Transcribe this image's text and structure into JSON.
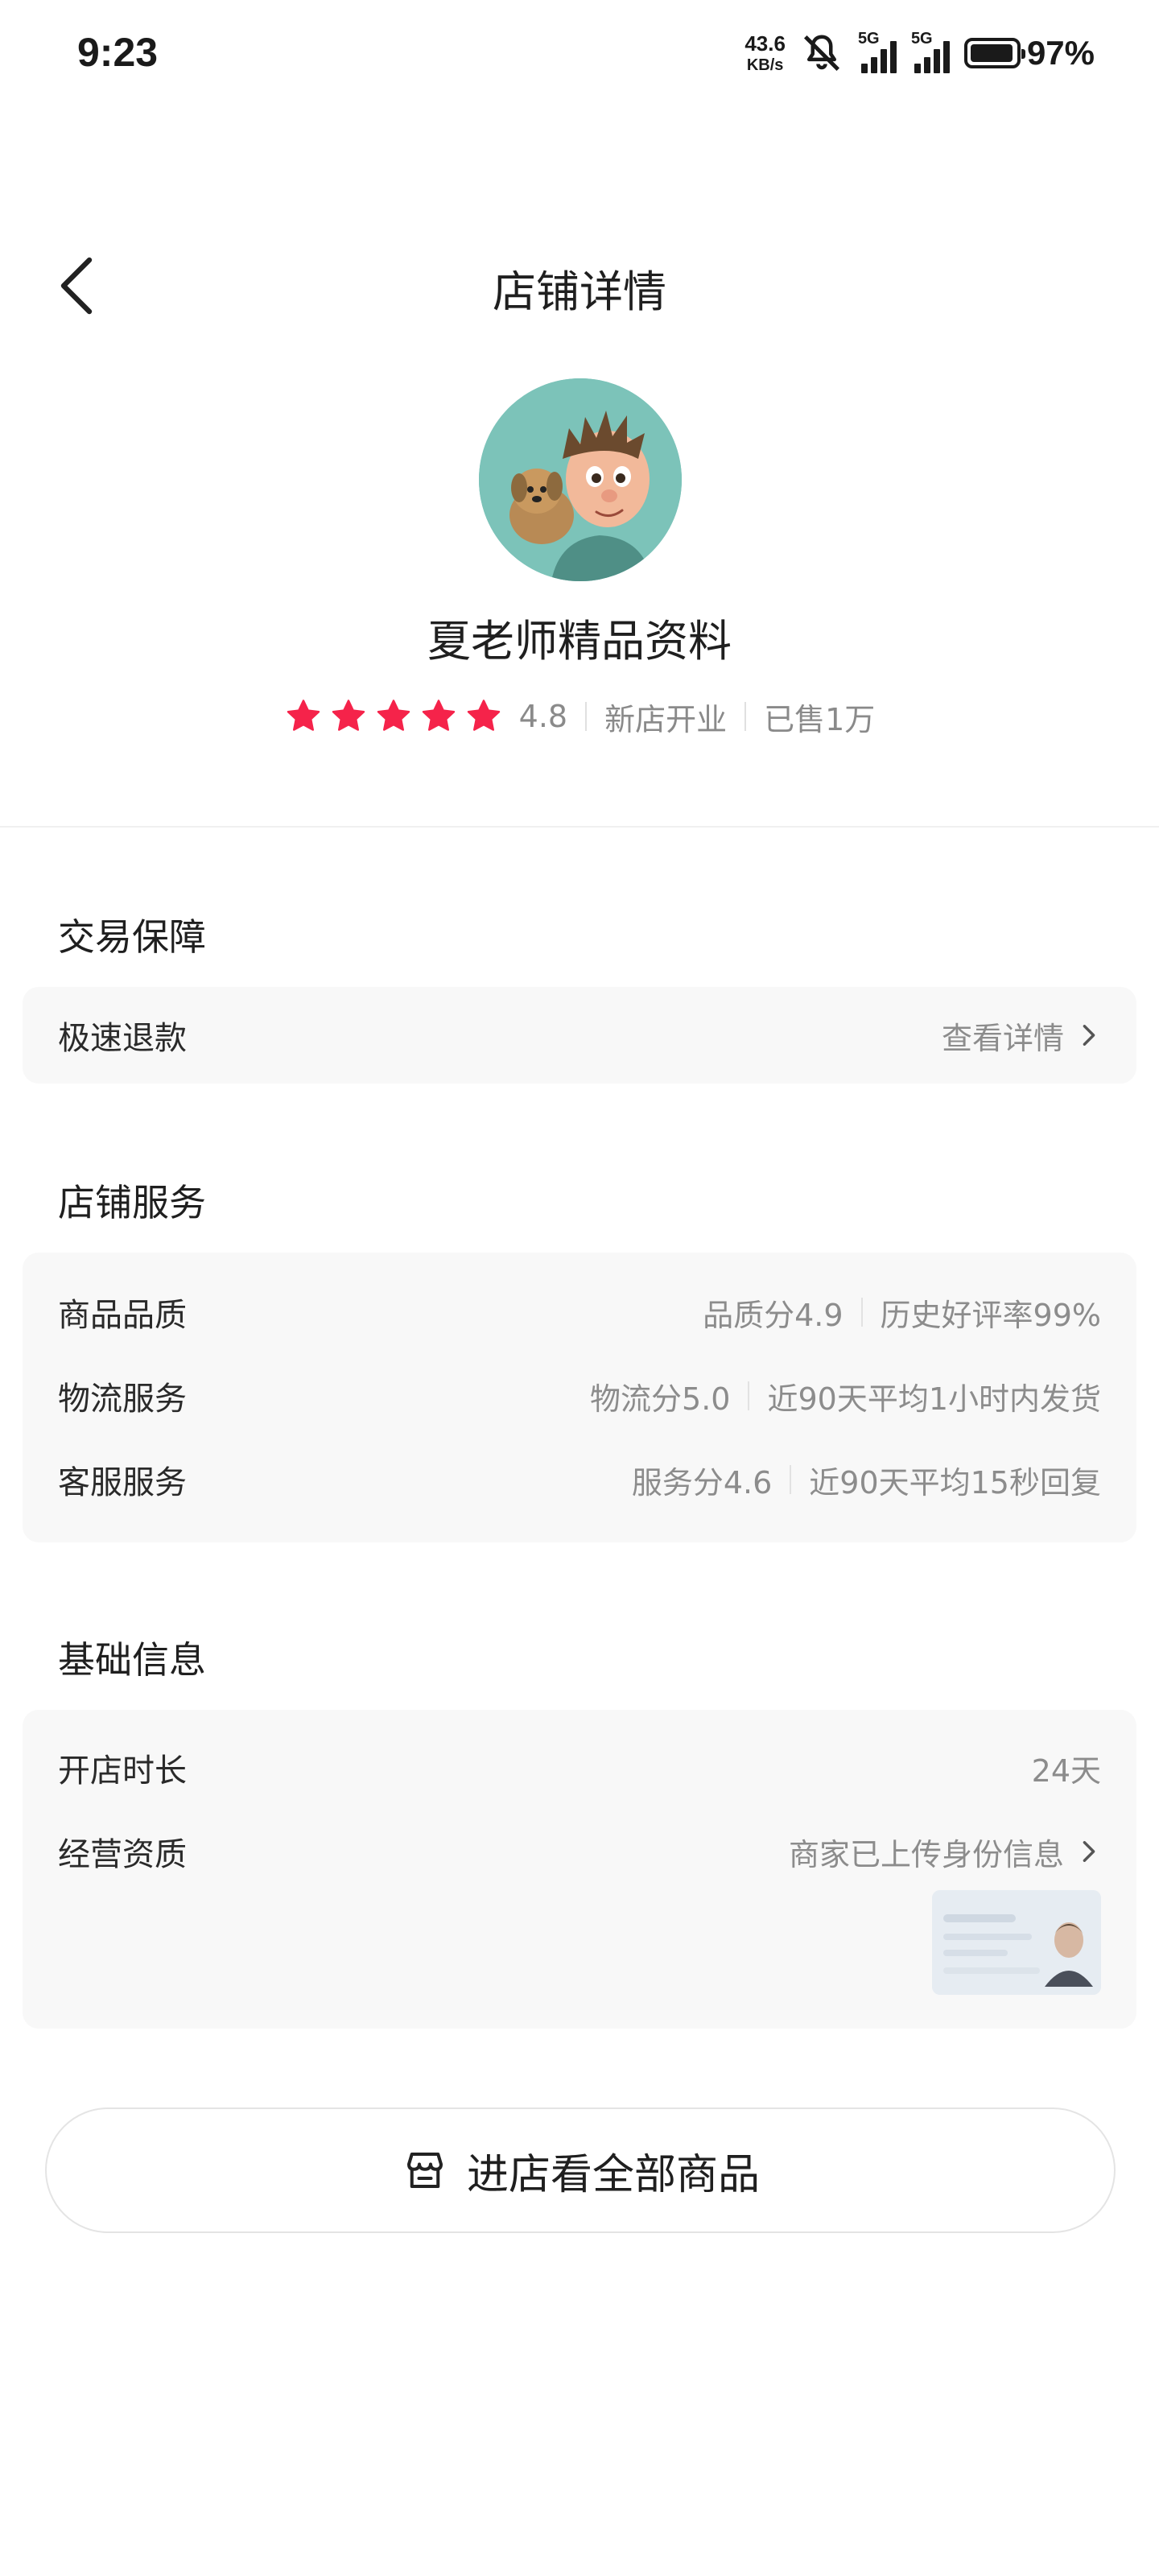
{
  "status_bar": {
    "time": "9:23",
    "net_speed_value": "43.6",
    "net_speed_unit": "KB/s",
    "signal_1_label": "5G",
    "signal_2_label": "5G",
    "battery_percent": "97%",
    "battery_level": 0.97
  },
  "header": {
    "title": "店铺详情"
  },
  "shop": {
    "name": "夏老师精品资料",
    "rating_stars": 5,
    "rating": "4.8",
    "badge": "新店开业",
    "sold": "已售1万"
  },
  "guarantee": {
    "title": "交易保障",
    "row_label": "极速退款",
    "row_action": "查看详情"
  },
  "service": {
    "title": "店铺服务",
    "rows": [
      {
        "label": "商品品质",
        "score": "品质分4.9",
        "detail": "历史好评率99%"
      },
      {
        "label": "物流服务",
        "score": "物流分5.0",
        "detail": "近90天平均1小时内发货"
      },
      {
        "label": "客服服务",
        "score": "服务分4.6",
        "detail": "近90天平均15秒回复"
      }
    ]
  },
  "basic": {
    "title": "基础信息",
    "duration_label": "开店时长",
    "duration_value": "24天",
    "qualification_label": "经营资质",
    "qualification_value": "商家已上传身份信息"
  },
  "enter_button": {
    "label": "进店看全部商品"
  },
  "colors": {
    "star": "#f5234a",
    "muted_text": "#8c8c8c",
    "card_bg": "#f8f8f8"
  },
  "icons": {
    "back": "chevron-left-icon",
    "star": "star-icon",
    "chevron": "chevron-right-icon",
    "shop": "shop-icon"
  }
}
